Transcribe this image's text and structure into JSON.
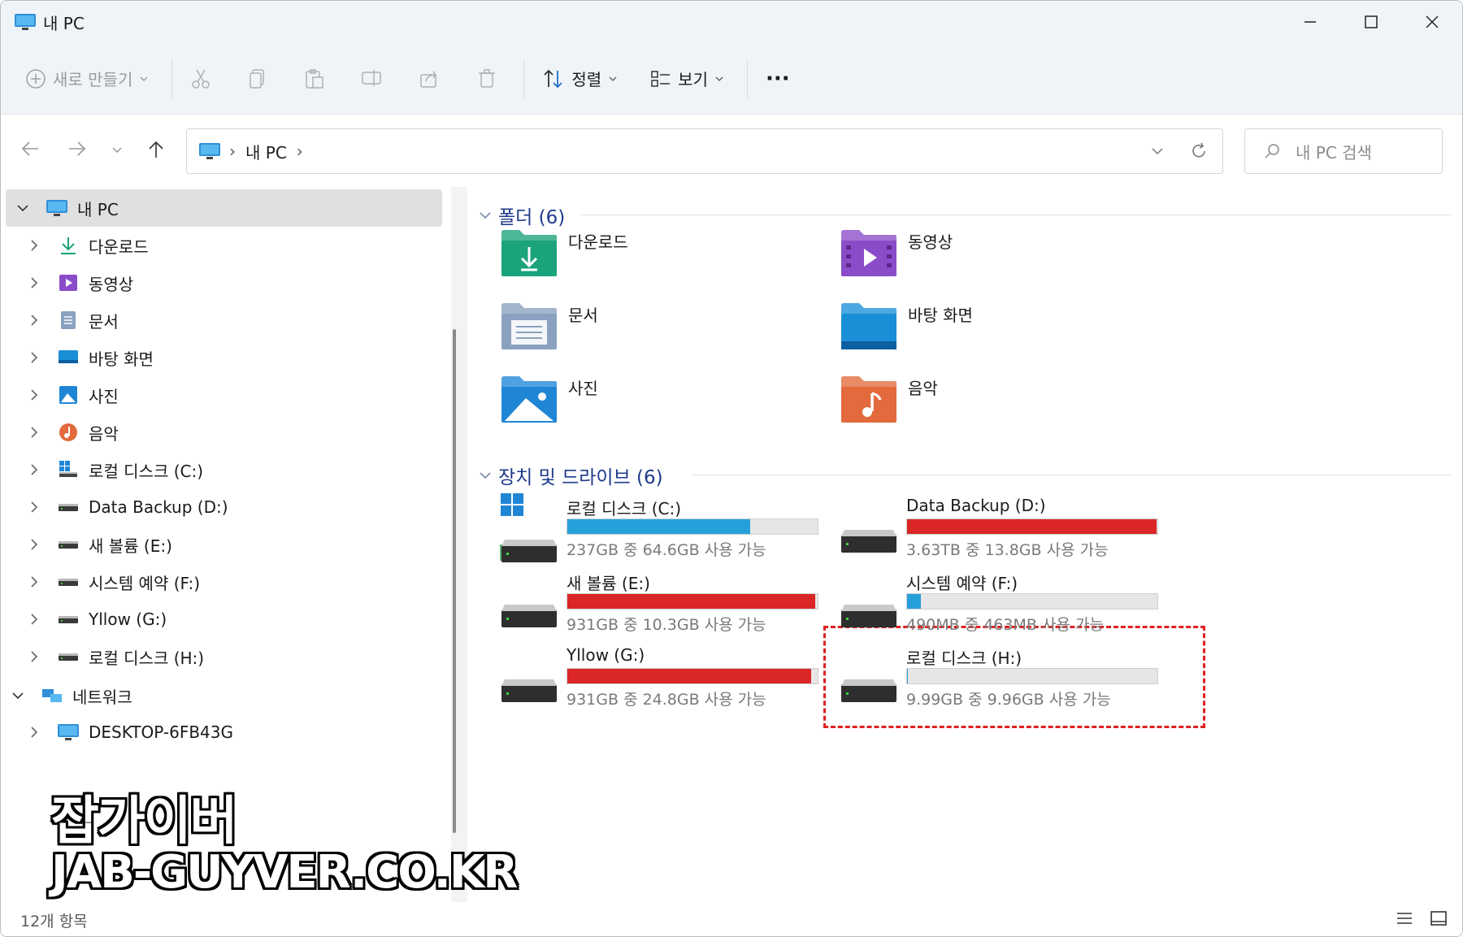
{
  "window": {
    "title": "내 PC"
  },
  "commandbar": {
    "new_label": "새로 만들기",
    "sort_label": "정렬",
    "view_label": "보기",
    "more_label": "···"
  },
  "address": {
    "crumb": "내 PC",
    "search_placeholder": "내 PC 검색"
  },
  "nav": {
    "items": [
      {
        "label": "내 PC",
        "icon": "pc-icon"
      },
      {
        "label": "다운로드",
        "icon": "download-icon"
      },
      {
        "label": "동영상",
        "icon": "video-icon"
      },
      {
        "label": "문서",
        "icon": "document-icon"
      },
      {
        "label": "바탕 화면",
        "icon": "desktop-icon"
      },
      {
        "label": "사진",
        "icon": "picture-icon"
      },
      {
        "label": "음악",
        "icon": "music-icon"
      },
      {
        "label": "로컬 디스크 (C:)",
        "icon": "windows-drive-icon"
      },
      {
        "label": "Data Backup (D:)",
        "icon": "drive-icon"
      },
      {
        "label": "새 볼륨 (E:)",
        "icon": "drive-icon"
      },
      {
        "label": "시스템 예약 (F:)",
        "icon": "drive-icon"
      },
      {
        "label": "Yllow (G:)",
        "icon": "drive-icon"
      },
      {
        "label": "로컬 디스크 (H:)",
        "icon": "drive-icon"
      },
      {
        "label": "네트워크",
        "icon": "network-icon"
      },
      {
        "label": "DESKTOP-6FB43G",
        "icon": "pc-icon"
      }
    ]
  },
  "groups": {
    "folders_title": "폴더 (6)",
    "drives_title": "장치 및 드라이브 (6)"
  },
  "folders": [
    {
      "label": "다운로드",
      "color": "#1ba37b"
    },
    {
      "label": "동영상",
      "color": "#8b4cc9"
    },
    {
      "label": "문서",
      "color": "#8aa2bf"
    },
    {
      "label": "바탕 화면",
      "color": "#1a8fd8"
    },
    {
      "label": "사진",
      "color": "#1f86d6"
    },
    {
      "label": "음악",
      "color": "#e26a3c"
    }
  ],
  "drives": [
    {
      "name": "로컬 디스크 (C:)",
      "free": "237GB 중 64.6GB 사용 가능",
      "used_fraction": 0.73,
      "bar_color": "#26a0da"
    },
    {
      "name": "Data Backup (D:)",
      "free": "3.63TB 중 13.8GB 사용 가능",
      "used_fraction": 0.996,
      "bar_color": "#da2626"
    },
    {
      "name": "새 볼륨 (E:)",
      "free": "931GB 중 10.3GB 사용 가능",
      "used_fraction": 0.989,
      "bar_color": "#da2626"
    },
    {
      "name": "시스템 예약 (F:)",
      "free": "490MB 중 463MB 사용 가능",
      "used_fraction": 0.055,
      "bar_color": "#26a0da"
    },
    {
      "name": "Yllow (G:)",
      "free": "931GB 중 24.8GB 사용 가능",
      "used_fraction": 0.973,
      "bar_color": "#da2626"
    },
    {
      "name": "로컬 디스크 (H:)",
      "free": "9.99GB 중 9.96GB 사용 가능",
      "used_fraction": 0.003,
      "bar_color": "#26a0da"
    }
  ],
  "status": {
    "count": "12개 항목"
  },
  "watermark": {
    "line1": "잡가이버",
    "line2": "JAB-GUYVER.CO.KR"
  },
  "colors": {
    "accent": "#1f3a8a",
    "highlight": "#e02020"
  }
}
